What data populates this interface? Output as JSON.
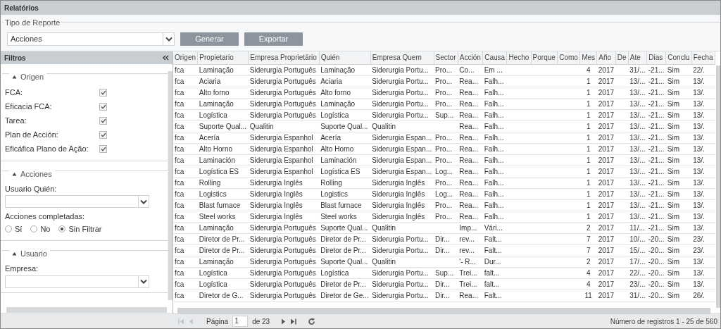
{
  "header": {
    "title": "Relatórios"
  },
  "report": {
    "legend": "Tipo de Reporte",
    "select_value": "Acciones",
    "buttons": [
      "Generar",
      "Exportar"
    ]
  },
  "filters": {
    "title": "Filtros",
    "sections": [
      {
        "title": "Origen",
        "expanded": true,
        "fields": [
          {
            "kind": "checkbox",
            "label": "FCA:",
            "checked": true
          },
          {
            "kind": "checkbox",
            "label": "Eficacia FCA:",
            "checked": true
          },
          {
            "kind": "checkbox",
            "label": "Tarea:",
            "checked": true
          },
          {
            "kind": "checkbox",
            "label": "Plan de Acción:",
            "checked": true
          },
          {
            "kind": "checkbox",
            "label": "Eficáfica Plano de Ação:",
            "checked": true
          }
        ]
      },
      {
        "title": "Acciones",
        "expanded": true,
        "fields": [
          {
            "kind": "dropdown",
            "label": "Usuario Quién:"
          },
          {
            "kind": "radios",
            "label": "Acciones completadas:",
            "options": [
              {
                "label": "Sí",
                "selected": false
              },
              {
                "label": "No",
                "selected": false
              },
              {
                "label": "Sin Filtrar",
                "selected": true
              }
            ]
          }
        ]
      },
      {
        "title": "Usuario",
        "expanded": true,
        "fields": [
          {
            "kind": "dropdown",
            "label": "Empresa:"
          }
        ]
      }
    ]
  },
  "grid": {
    "columns": [
      "Origen",
      "Propietario",
      "Empresa Proprietário",
      "Quién",
      "Empresa Quem",
      "Sector",
      "Acción",
      "Causa",
      "Hecho",
      "Porque",
      "Como",
      "Mes",
      "Año",
      "De",
      "Ate",
      "Dias",
      "Conclu",
      "Fecha"
    ],
    "rows": [
      {
        "cells": [
          "fca",
          "Laminação",
          "Siderurgia Português",
          "Laminação",
          "Siderurgia Portu...",
          "Pro...",
          "Co...",
          "Em ...",
          null,
          null,
          null,
          "4",
          "2017",
          null,
          "31/...",
          "-21...",
          "Sim",
          "22/."
        ]
      },
      {
        "cells": [
          "fca",
          "Aciaria",
          "Siderurgia Português",
          "Aciaria",
          "Siderurgia Portu...",
          "Pro...",
          "Rea...",
          "Falh...",
          null,
          null,
          null,
          "1",
          "2017",
          null,
          "13/...",
          "-21...",
          "Sim",
          "13/."
        ]
      },
      {
        "cells": [
          "fca",
          "Alto forno",
          "Siderurgia Português",
          "Alto forno",
          "Siderurgia Portu...",
          "Pro...",
          "Rea...",
          "Falh...",
          null,
          null,
          null,
          "1",
          "2017",
          null,
          "13/...",
          "-21...",
          "Sim",
          "13/."
        ]
      },
      {
        "cells": [
          "fca",
          "Laminação",
          "Siderurgia Português",
          "Laminação",
          "Siderurgia Portu...",
          "Pro...",
          "Rea...",
          "Falh...",
          null,
          null,
          null,
          "1",
          "2017",
          null,
          "13/...",
          "-21...",
          "Sim",
          "13/."
        ]
      },
      {
        "cells": [
          "fca",
          "Logística",
          "Siderurgia Português",
          "Logística",
          "Siderurgia Portu...",
          "Sup...",
          "Rea...",
          "Falh...",
          null,
          null,
          null,
          "1",
          "2017",
          null,
          "13/...",
          "-21...",
          "Sim",
          "13/."
        ]
      },
      {
        "cells": [
          "fca",
          "Suporte Qual...",
          "Qualitin",
          "Suporte Qual...",
          "Qualitin",
          null,
          "Rea...",
          "Falh...",
          null,
          null,
          null,
          "1",
          "2017",
          null,
          "13/...",
          "-21...",
          "Sim",
          "13/."
        ]
      },
      {
        "cells": [
          "fca",
          "Acería",
          "Siderurgia Espanhol",
          "Acería",
          "Siderurgia Espan...",
          "Pro...",
          "Rea...",
          "Falh...",
          null,
          null,
          null,
          "1",
          "2017",
          null,
          "13/...",
          "-21...",
          "Sim",
          "13/."
        ]
      },
      {
        "cells": [
          "fca",
          "Alto Horno",
          "Siderurgia Espanhol",
          "Alto Horno",
          "Siderurgia Espan...",
          "Pro...",
          "Rea...",
          "Falh...",
          null,
          null,
          null,
          "1",
          "2017",
          null,
          "13/...",
          "-21...",
          "Sim",
          "13/."
        ]
      },
      {
        "cells": [
          "fca",
          "Laminación",
          "Siderurgia Espanhol",
          "Laminación",
          "Siderurgia Espan...",
          "Pro...",
          "Rea...",
          "Falh...",
          null,
          null,
          null,
          "1",
          "2017",
          null,
          "13/...",
          "-21...",
          "Sim",
          "13/."
        ]
      },
      {
        "cells": [
          "fca",
          "Logística ES",
          "Siderurgia Espanhol",
          "Logística ES",
          "Siderurgia Espan...",
          "Log...",
          "Rea...",
          "Falh...",
          null,
          null,
          null,
          "1",
          "2017",
          null,
          "13/...",
          "-21...",
          "Sim",
          "13/."
        ]
      },
      {
        "cells": [
          "fca",
          "Rolling",
          "Siderurgia Inglês",
          "Rolling",
          "Siderurgia Inglês",
          "Pro...",
          "Rea...",
          "Falh...",
          null,
          null,
          null,
          "1",
          "2017",
          null,
          "13/...",
          "-21...",
          "Sim",
          "13/."
        ]
      },
      {
        "cells": [
          "fca",
          "Logistics",
          "Siderurgia Inglês",
          "Logistics",
          "Siderurgia Inglês",
          "Log...",
          "Rea...",
          "Falh...",
          null,
          null,
          null,
          "1",
          "2017",
          null,
          "13/...",
          "-21...",
          "Sim",
          "13/."
        ]
      },
      {
        "cells": [
          "fca",
          "Blast furnace",
          "Siderurgia Inglês",
          "Blast furnace",
          "Siderurgia Inglês",
          "Pro...",
          "Rea...",
          "Falh...",
          null,
          null,
          null,
          "1",
          "2017",
          null,
          "13/...",
          "-21...",
          "Sim",
          "13/."
        ]
      },
      {
        "cells": [
          "fca",
          "Steel works",
          "Siderurgia Inglês",
          "Steel works",
          "Siderurgia Inglês",
          "Pro...",
          "Rea...",
          "Falh...",
          null,
          null,
          null,
          "1",
          "2017",
          null,
          "13/...",
          "-21...",
          "Sim",
          "13/."
        ]
      },
      {
        "cells": [
          "fca",
          "Laminação",
          "Siderurgia Português",
          "Suporte Qual...",
          "Qualitin",
          null,
          "Imp...",
          "Vári...",
          null,
          null,
          null,
          "2",
          "2017",
          null,
          "11/...",
          "-21...",
          "Sim",
          "13/."
        ]
      },
      {
        "cells": [
          "fca",
          "Diretor de Pr...",
          "Siderurgia Português",
          "Diretor de Pr...",
          "Siderurgia Portu...",
          "Dir...",
          "rev...",
          "Falt...",
          null,
          null,
          null,
          "7",
          "2017",
          null,
          "10/...",
          "-20...",
          "Sim",
          "23/."
        ]
      },
      {
        "cells": [
          "fca",
          "Diretor de Pr...",
          "Siderurgia Português",
          "Diretor de Pr...",
          "Siderurgia Portu...",
          "Dir...",
          "rev...",
          "Falt...",
          null,
          null,
          null,
          "7",
          "2017",
          null,
          "15/...",
          "-20...",
          "Sim",
          "23/."
        ]
      },
      {
        "cells": [
          "fca",
          "Laminação",
          "Siderurgia Português",
          "Suporte Qual...",
          "Qualitin",
          null,
          "'- R...",
          "Dur...",
          null,
          null,
          null,
          "2",
          "2017",
          null,
          "17/...",
          "-20...",
          "Sim",
          "13/."
        ]
      },
      {
        "cells": [
          "fca",
          "Logística",
          "Siderurgia Português",
          "Logística",
          "Siderurgia Portu...",
          "Sup...",
          "Trei...",
          "falt...",
          null,
          null,
          null,
          "4",
          "2017",
          null,
          "22/...",
          "-20...",
          "Sim",
          "13/."
        ]
      },
      {
        "cells": [
          "fca",
          "Logística",
          "Siderurgia Português",
          "Diretor de Pr...",
          "Siderurgia Portu...",
          "Dir...",
          "Trei...",
          "falt...",
          null,
          null,
          null,
          "4",
          "2017",
          null,
          "23/...",
          "-20...",
          "Sim",
          "13/."
        ]
      },
      {
        "cells": [
          "fca",
          "Diretor de G...",
          "Siderurgia Português",
          "Diretor de Ge...",
          "Siderurgia Portu...",
          "Dir...",
          "Rea...",
          "Falt...",
          null,
          null,
          null,
          "11",
          "2017",
          null,
          "31/...",
          "-20...",
          "Sim",
          "26/."
        ]
      }
    ]
  },
  "pager": {
    "back_disabled": true,
    "forward_disabled": false,
    "page_label": "Página",
    "page": "1",
    "of": "de 23",
    "summary": "Número de registros 1 - 25 de 560"
  }
}
